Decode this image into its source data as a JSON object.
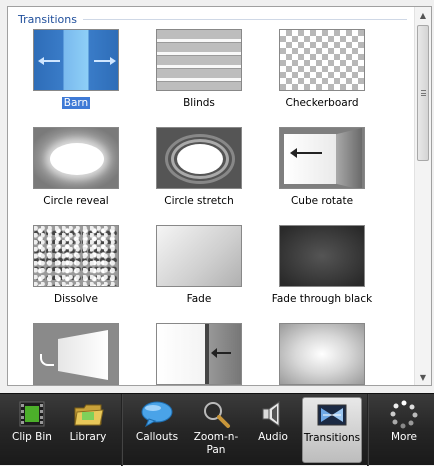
{
  "panel": {
    "title": "Transitions"
  },
  "transitions": [
    {
      "label": "Barn",
      "selected": true
    },
    {
      "label": "Blinds"
    },
    {
      "label": "Checkerboard"
    },
    {
      "label": "Circle reveal"
    },
    {
      "label": "Circle stretch"
    },
    {
      "label": "Cube rotate"
    },
    {
      "label": "Dissolve"
    },
    {
      "label": "Fade"
    },
    {
      "label": "Fade through black"
    },
    {
      "label": ""
    },
    {
      "label": ""
    },
    {
      "label": ""
    }
  ],
  "toolbar": {
    "items": [
      {
        "label": "Clip Bin",
        "icon": "film-strip-icon"
      },
      {
        "label": "Library",
        "icon": "folder-icon"
      },
      {
        "label": "Callouts",
        "icon": "speech-bubble-icon"
      },
      {
        "label": "Zoom-n-\nPan",
        "icon": "magnifier-icon"
      },
      {
        "label": "Audio",
        "icon": "speaker-icon"
      },
      {
        "label": "Transitions",
        "icon": "transitions-icon",
        "active": true
      },
      {
        "label": "More",
        "icon": "more-dots-icon"
      }
    ]
  }
}
